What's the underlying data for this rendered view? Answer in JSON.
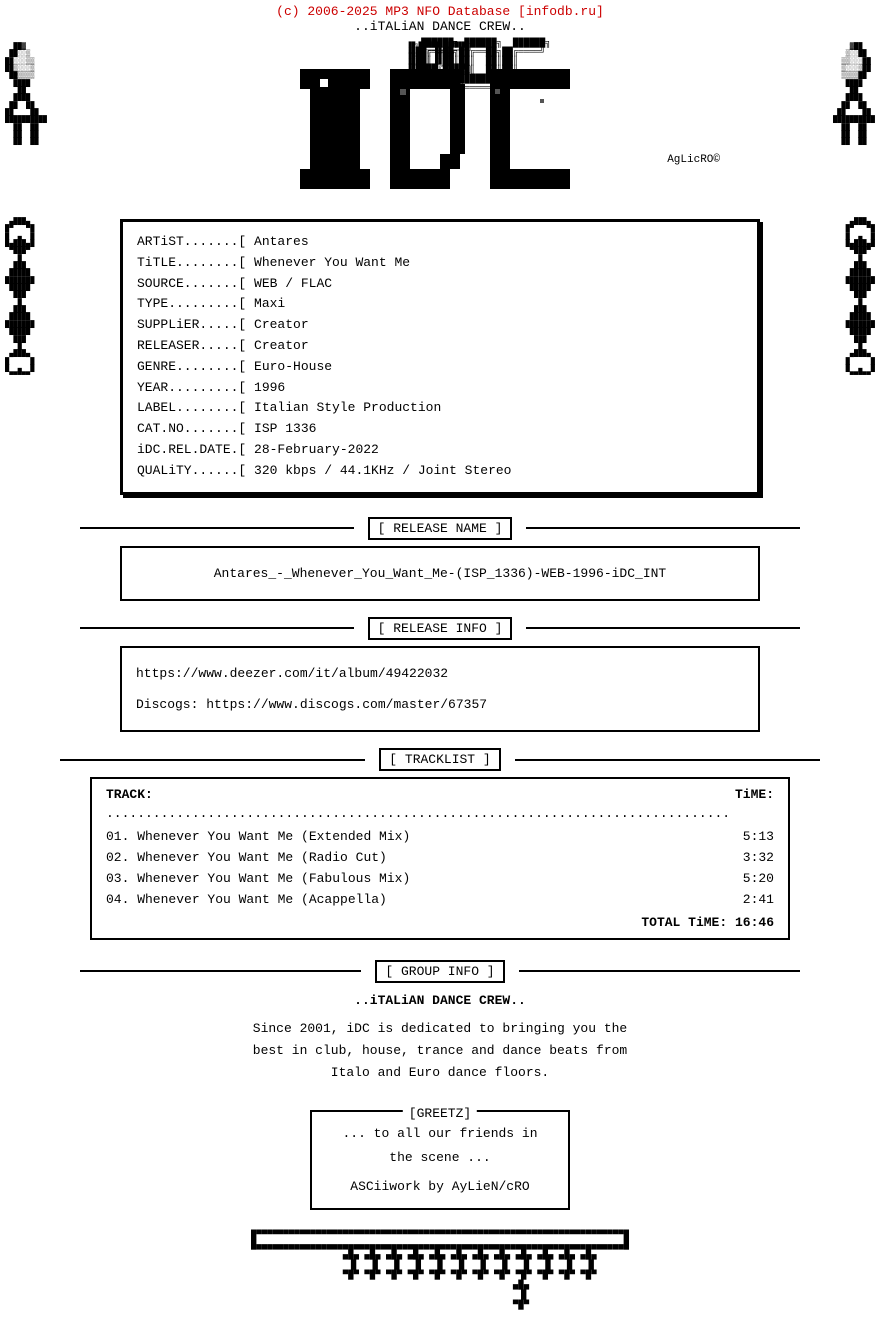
{
  "header": {
    "copyright": "(c) 2006-2025 MP3 NFO Database [infodb.ru]",
    "crew": "..iTALiAN DANCE CREW.."
  },
  "aylicro": "AgLicRO©",
  "info": {
    "artist_label": "ARTiST",
    "artist_value": "Antares",
    "title_label": "TiTLE",
    "title_value": "Whenever You Want Me",
    "source_label": "SOURCE",
    "source_value": "WEB / FLAC",
    "type_label": "TYPE",
    "type_value": "Maxi",
    "supplier_label": "SUPPLiER",
    "supplier_value": "Creator",
    "releaser_label": "RELEASER",
    "releaser_value": "Creator",
    "genre_label": "GENRE",
    "genre_value": "Euro-House",
    "year_label": "YEAR",
    "year_value": "1996",
    "label_label": "LABEL",
    "label_value": "Italian Style Production",
    "catno_label": "CAT.NO.",
    "catno_value": "ISP 1336",
    "reldate_label": "iDC.REL.DATE",
    "reldate_value": "28-February-2022",
    "quality_label": "QUALiTY",
    "quality_value": "320 kbps / 44.1KHz / Joint Stereo"
  },
  "sections": {
    "release_name_label": "[ RELEASE NAME ]",
    "release_info_label": "[ RELEASE INFO ]",
    "tracklist_label": "[ TRACKLIST ]",
    "group_info_label": "[ GROUP INFO ]",
    "greetz_label": "[GREETZ]"
  },
  "release_name": "Antares_-_Whenever_You_Want_Me-(ISP_1336)-WEB-1996-iDC_INT",
  "release_info": {
    "line1": "https://www.deezer.com/it/album/49422032",
    "line2": "Discogs: https://www.discogs.com/master/67357"
  },
  "tracklist": {
    "track_header": "TRACK:",
    "time_header": "TiME:",
    "dots": "................................................................................",
    "tracks": [
      {
        "num": "01.",
        "title": "Whenever You Want Me (Extended Mix)",
        "time": "5:13"
      },
      {
        "num": "02.",
        "title": "Whenever You Want Me (Radio Cut)",
        "time": "3:32"
      },
      {
        "num": "03.",
        "title": "Whenever You Want Me (Fabulous Mix)",
        "time": "5:20"
      },
      {
        "num": "04.",
        "title": "Whenever You Want Me (Acappella)",
        "time": "2:41"
      }
    ],
    "total_label": "TOTAL TiME:",
    "total_time": "16:46"
  },
  "group_info": {
    "name": "..iTALiAN DANCE CREW..",
    "description": "Since 2001, iDC is dedicated to bringing you the\nbest in club, house, trance and dance beats from\nItalo and Euro dance floors."
  },
  "greetz": {
    "line1": "... to all our friends in",
    "line2": "the scene ...",
    "line3": "ASCiiwork by AyLieN/cRO"
  }
}
